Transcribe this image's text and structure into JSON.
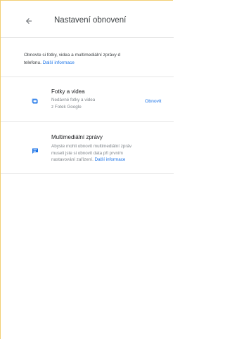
{
  "header": {
    "title": "Nastavení obnovení"
  },
  "intro": {
    "text": "Obnovte si fotky, videa a multimediální zprávy d",
    "line2": "telefonu.",
    "link": "Další informace"
  },
  "items": [
    {
      "title": "Fotky a videa",
      "subtitle_line1": "Nedávné fotky a videa",
      "subtitle_line2": "z Fotek Google",
      "action": "Obnovit",
      "icon": "photos-icon"
    },
    {
      "title": "Multimediální zprávy",
      "subtitle_line1": "Abyste mohli obnovit multimediální zpráv",
      "subtitle_line2": "museli jste si obnovit data při prvním",
      "subtitle_line3": "nastavování zařízení.",
      "link": "Další informace",
      "icon": "message-icon"
    }
  ],
  "colors": {
    "accent": "#1a73e8",
    "frame": "#f2cf73",
    "text": "#3c4043",
    "muted": "#80868b",
    "divider": "#e6e6e6"
  }
}
